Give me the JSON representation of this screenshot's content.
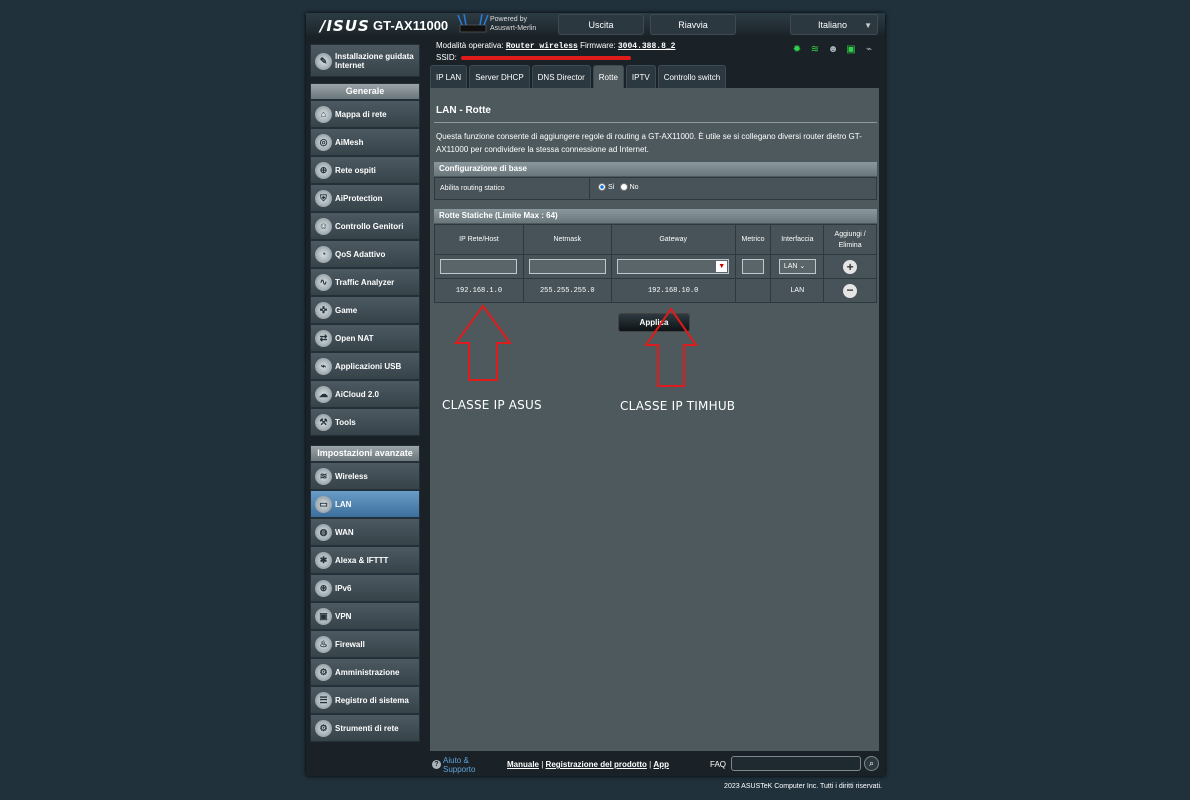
{
  "header": {
    "logo": "/ISUS",
    "model": "GT-AX11000",
    "powered_line1": "Powered by",
    "powered_line2": "Asuswrt-Merlin",
    "logout_label": "Uscita",
    "reboot_label": "Riavvia",
    "language": "Italiano"
  },
  "status": {
    "mode_label": "Modalità operativa:",
    "mode_value": "Router wireless",
    "firmware_label": "Firmware:",
    "firmware_value": "3004.388.8_2",
    "ssid_label": "SSID:"
  },
  "sidebar": {
    "qis_label": "Installazione guidata Internet",
    "general_header": "Generale",
    "general_items": [
      {
        "label": "Mappa di rete",
        "icon": "network-map-icon",
        "glyph": "⌂"
      },
      {
        "label": "AiMesh",
        "icon": "aimesh-icon",
        "glyph": "◎"
      },
      {
        "label": "Rete ospiti",
        "icon": "guest-network-icon",
        "glyph": "⊕"
      },
      {
        "label": "AiProtection",
        "icon": "shield-icon",
        "glyph": "⛨"
      },
      {
        "label": "Controllo Genitori",
        "icon": "parental-control-icon",
        "glyph": "☺"
      },
      {
        "label": "QoS Adattivo",
        "icon": "qos-icon",
        "glyph": "◔"
      },
      {
        "label": "Traffic Analyzer",
        "icon": "traffic-analyzer-icon",
        "glyph": "∿"
      },
      {
        "label": "Game",
        "icon": "gamepad-icon",
        "glyph": "✜"
      },
      {
        "label": "Open NAT",
        "icon": "open-nat-icon",
        "glyph": "⇄"
      },
      {
        "label": "Applicazioni USB",
        "icon": "usb-icon",
        "glyph": "⌁"
      },
      {
        "label": "AiCloud 2.0",
        "icon": "cloud-icon",
        "glyph": "☁"
      },
      {
        "label": "Tools",
        "icon": "wrench-icon",
        "glyph": "⚒"
      }
    ],
    "advanced_header": "Impostazioni avanzate",
    "advanced_items": [
      {
        "label": "Wireless",
        "icon": "wireless-icon",
        "glyph": "≋"
      },
      {
        "label": "LAN",
        "icon": "lan-icon",
        "glyph": "▭",
        "active": true
      },
      {
        "label": "WAN",
        "icon": "wan-icon",
        "glyph": "◍"
      },
      {
        "label": "Alexa & IFTTT",
        "icon": "alexa-icon",
        "glyph": "✱"
      },
      {
        "label": "IPv6",
        "icon": "ipv6-icon",
        "glyph": "⊛"
      },
      {
        "label": "VPN",
        "icon": "vpn-icon",
        "glyph": "▣"
      },
      {
        "label": "Firewall",
        "icon": "firewall-icon",
        "glyph": "♨"
      },
      {
        "label": "Amministrazione",
        "icon": "administration-icon",
        "glyph": "⚙"
      },
      {
        "label": "Registro di sistema",
        "icon": "system-log-icon",
        "glyph": "☰"
      },
      {
        "label": "Strumenti di rete",
        "icon": "network-tools-icon",
        "glyph": "⚙"
      }
    ]
  },
  "tabs": [
    "IP LAN",
    "Server DHCP",
    "DNS Director",
    "Rotte",
    "IPTV",
    "Controllo switch"
  ],
  "active_tab": "Rotte",
  "main": {
    "title": "LAN - Rotte",
    "description": "Questa funzione consente di aggiungere regole di routing a GT-AX11000. È utile se si collegano diversi router dietro GT-AX11000 per condividere la stessa connessione ad Internet.",
    "basic_header": "Configurazione di base",
    "enable_static_label": "Abilita routing statico",
    "radio_yes": "Sì",
    "radio_no": "No",
    "radio_selected": "Sì",
    "static_header": "Rotte Statiche (Limite Max : 64)",
    "columns": [
      "IP Rete/Host",
      "Netmask",
      "Gateway",
      "Metrico",
      "Interfaccia",
      "Aggiungi / Elimina"
    ],
    "input_row": {
      "interface": "LAN"
    },
    "routes": [
      {
        "ip": "192.168.1.0",
        "netmask": "255.255.255.0",
        "gateway": "192.168.10.0",
        "metric": "",
        "interface": "LAN"
      }
    ],
    "apply_label": "Applica"
  },
  "footer": {
    "help_line1": "Aiuto &",
    "help_line2": "Supporto",
    "manual": "Manuale",
    "registration": "Registrazione del prodotto",
    "app": "App",
    "faq": "FAQ",
    "copyright": "2023 ASUSTeK Computer Inc. Tutti i diritti riservati."
  },
  "annotations": {
    "left_label": "CLASSE IP ASUS",
    "right_label": "CLASSE IP TIMHUB",
    "color": "#e01b1b"
  }
}
